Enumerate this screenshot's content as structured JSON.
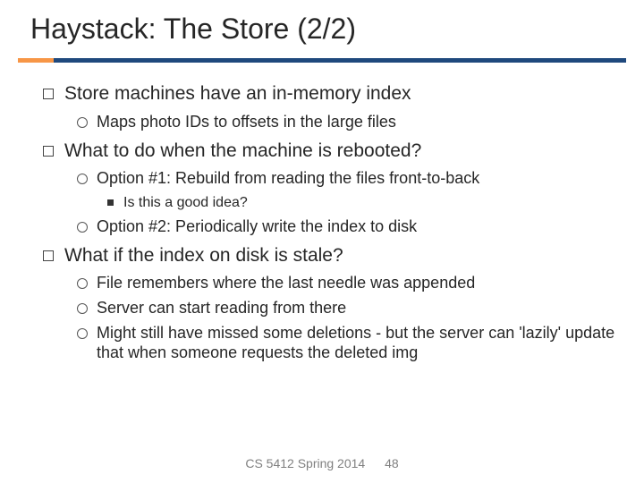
{
  "title": "Haystack: The Store (2/2)",
  "bullets": {
    "b1": "Store machines have an in-memory index",
    "b1_1": "Maps photo IDs to offsets in the large files",
    "b2": "What to do when the machine is rebooted?",
    "b2_1": "Option #1: Rebuild from reading the files front-to-back",
    "b2_1_1": "Is this a good idea?",
    "b2_2": "Option #2: Periodically write the index to disk",
    "b3": "What if the index on disk is stale?",
    "b3_1": "File remembers where the last needle was appended",
    "b3_2": "Server can start reading from there",
    "b3_3": "Might still have missed some deletions - but the server can 'lazily' update that when someone requests the deleted img"
  },
  "footer": {
    "course": "CS 5412 Spring 2014",
    "page": "48"
  }
}
